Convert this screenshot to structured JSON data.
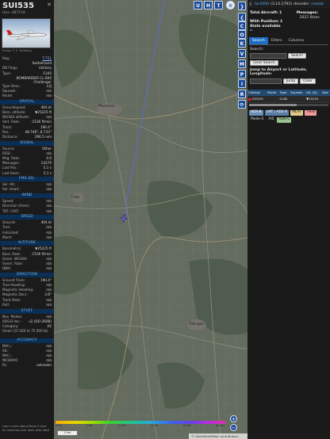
{
  "left_panel": {
    "callsign": "SUI535",
    "hex": "Hex: 4B7F44",
    "photo_credit": "Image © G. Nuβberg",
    "reg_label": "Reg.:",
    "reg_value": "T-751",
    "country_label": "",
    "country_value": "Switzerland",
    "dbflags_label": "DB Flags:",
    "dbflags_value": "military",
    "type_label": "Type:",
    "type_value": "CL60",
    "typename_value": "BOMBARDIER CL-600 Challenger",
    "typedesc_label": "Type Desc.:",
    "typedesc_value": "L2J",
    "squawk_label": "Squawk:",
    "squawk_value": "n/a",
    "route_label": "Route:",
    "route_value": "n/a",
    "sections": {
      "spatial": "SPATIAL",
      "signal": "SIGNAL",
      "fms": "FMS SEL",
      "wind": "WIND",
      "speed": "SPEED",
      "altitude": "ALTITUDE",
      "direction": "DIRECTION",
      "stuff": "STUFF",
      "accuracy": "ACCURACY"
    },
    "spatial": [
      {
        "k": "Groundspeed:",
        "v": "464 kt"
      },
      {
        "k": "Baro. altitude:",
        "v": "▼25225 ft"
      },
      {
        "k": "WGS84 altitude:",
        "v": "n/a"
      },
      {
        "k": "Vert. Rate:",
        "v": "-1536 ft/min"
      },
      {
        "k": "Track:",
        "v": "190.4°"
      },
      {
        "k": "Pos.:",
        "v": "48.746°, 8.733°"
      },
      {
        "k": "Distance:",
        "v": "296.5 nmi"
      }
    ],
    "signal": [
      {
        "k": "Source:",
        "v": "Other"
      },
      {
        "k": "RSSI:",
        "v": "n/a"
      },
      {
        "k": "Msg. Rate:",
        "v": "0.0"
      },
      {
        "k": "Messages:",
        "v": "14270"
      },
      {
        "k": "Last Pos.:",
        "v": "5.1 s"
      },
      {
        "k": "Last Seen:",
        "v": "5.1 s"
      }
    ],
    "fms": [
      {
        "k": "Sel. Alt.:",
        "v": "n/a"
      },
      {
        "k": "Sel. Head.:",
        "v": "n/a"
      }
    ],
    "wind": [
      {
        "k": "Speed:",
        "v": "n/a"
      },
      {
        "k": "Direction (from):",
        "v": "n/a"
      },
      {
        "k": "TAT / OAT:",
        "v": "n/a"
      }
    ],
    "speed": [
      {
        "k": "Ground:",
        "v": "464 kt"
      },
      {
        "k": "True:",
        "v": "n/a"
      },
      {
        "k": "Indicated:",
        "v": "n/a"
      },
      {
        "k": "Mach:",
        "v": "n/a"
      }
    ],
    "altitude": [
      {
        "k": "Barometric:",
        "v": "▼25225 ft"
      },
      {
        "k": "Baro. Rate:",
        "v": "-1536 ft/min"
      },
      {
        "k": "Geom. WGS84:",
        "v": "n/a"
      },
      {
        "k": "Geom. Rate:",
        "v": "n/a"
      },
      {
        "k": "QNH:",
        "v": "n/a"
      }
    ],
    "direction": [
      {
        "k": "Ground Track:",
        "v": "190.4°"
      },
      {
        "k": "True Heading:",
        "v": "n/a"
      },
      {
        "k": "Magnetic Heading:",
        "v": "n/a"
      },
      {
        "k": "Magnetic Decl.:",
        "v": "3.8°"
      },
      {
        "k": "Track Rate:",
        "v": "n/a"
      },
      {
        "k": "Roll:",
        "v": "n/a"
      }
    ],
    "stuff": [
      {
        "k": "Nav. Modes:",
        "v": "n/a"
      },
      {
        "k": "ADS-B Ver.:",
        "v": "v2 (DO-260B)"
      },
      {
        "k": "Category:",
        "v": "A2"
      }
    ],
    "category_desc": "Small (15 500 to 75 000 lb)",
    "accuracy": [
      {
        "k": "NACₚ:",
        "v": "n/a"
      },
      {
        "k": "SIL:",
        "v": "n/a"
      },
      {
        "k": "NACᵥ:",
        "v": "n/a"
      },
      {
        "k": "NICBARO:",
        "v": "n/a"
      },
      {
        "k": "Rc:",
        "v": "unknown"
      }
    ],
    "footer_text": "Learn more about Mode S type by hovering over each data label"
  },
  "map": {
    "towns": [
      "Pforzheim",
      "Calw",
      "Tübingen"
    ],
    "top_buttons": [
      "U",
      "H",
      "T"
    ],
    "side_buttons": [
      "C",
      "O",
      "K",
      "V",
      "M",
      "P",
      "I",
      "R"
    ],
    "altitude_ticks": [
      "2 000",
      "6 000",
      "10 000",
      "20 000",
      "30 000",
      "40 000+"
    ],
    "scale_label": "2 km",
    "attribution": "© OpenStreetMap contributors.",
    "zoom_in": "+",
    "zoom_out": "−"
  },
  "right_panel": {
    "version_prefix": "tar1090",
    "version": "(3.14.1793)",
    "decoder_prefix": "decoder:",
    "decoder_link": "readsb",
    "total_aircraft_label": "Total Aircraft:",
    "total_aircraft_value": "1",
    "messages_label": "Messages:",
    "messages_value": "2027.9/sec",
    "with_position_label": "With Position:",
    "with_position_value": "1",
    "stats_link": "Stats available",
    "tabs": [
      "Search",
      "Filters",
      "Columns"
    ],
    "search_label": "Search:",
    "search_button": "Search",
    "clear_search_button": "Clear Search",
    "jump_label": "Jump to Airport or Latitude, Longitude:",
    "jump_button": "Jump",
    "clear_button": "Clear",
    "table": {
      "headers": [
        "Callsign",
        "Route",
        "Type",
        "Squawk",
        "Alt. (ft)",
        "Spd"
      ],
      "rows": [
        {
          "callsign": "SUI535",
          "route": "",
          "type": "CL60",
          "squawk": "",
          "alt": "▼25225",
          "spd": ""
        }
      ]
    },
    "sources": [
      "ADS-B",
      "UAT / ADS-R",
      "MLAT",
      "TIS-B",
      "Mode-S",
      "AIS",
      "ADS-C"
    ]
  }
}
